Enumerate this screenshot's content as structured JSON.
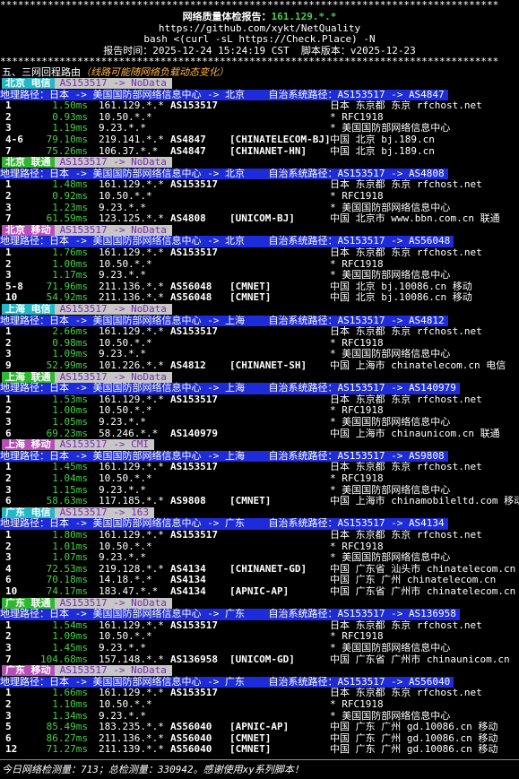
{
  "header": {
    "stars": "************************************************************************************",
    "title_prefix": "网络质量体检报告：",
    "title_ip": "161.129.*.*",
    "url": "https://github.com/xykt/NetQuality",
    "cmd": "bash <(curl -sL https://Check.Place) -N",
    "report_time": "报告时间：2025-12-24 15:24:19 CST  脚本版本：v2025-12-23",
    "stars2": "************************************************************************************"
  },
  "section": {
    "title": "五、三网回程路由",
    "note": "（线路可能随网络负载动态变化）"
  },
  "routes": [
    {
      "badge": "北京 电信",
      "badge_type": "ct",
      "as_badge": "AS153517 -> NoData",
      "geo": "地理路径：日本 -> 美国国防部网络信息中心 -> 北京    自治系统路径：AS153517 -> AS4847",
      "hops": [
        {
          "n": "1",
          "ms": "1.50ms",
          "ip": "161.129.*.*",
          "asn": "AS153517",
          "isp": "",
          "loc": "日本 东京都 东京 rfchost.net"
        },
        {
          "n": "2",
          "ms": "0.93ms",
          "ip": "10.50.*.*",
          "asn": "",
          "isp": "",
          "loc": "* RFC1918"
        },
        {
          "n": "3",
          "ms": "1.19ms",
          "ip": "9.23.*.*",
          "asn": "",
          "isp": "",
          "loc": "* 美国国防部网络信息中心"
        },
        {
          "n": "4-6",
          "ms": "79.10ms",
          "ip": "219.141.*.*",
          "asn": "AS4847",
          "isp": "[CHINATELECOM-BJ]",
          "loc": "中国 北京 bj.189.cn"
        },
        {
          "n": "7",
          "ms": "75.26ms",
          "ip": "106.37.*.*",
          "asn": "AS4847",
          "isp": "[CHINANET-HN]",
          "loc": "中国 北京 bj.189.cn"
        }
      ]
    },
    {
      "badge": "北京 联通",
      "badge_type": "cu",
      "as_badge": "AS153517 -> NoData",
      "geo": "地理路径：日本 -> 美国国防部网络信息中心 -> 北京    自治系统路径：AS153517 -> AS4808",
      "hops": [
        {
          "n": "1",
          "ms": "1.48ms",
          "ip": "161.129.*.*",
          "asn": "AS153517",
          "isp": "",
          "loc": "日本 东京都 东京 rfchost.net"
        },
        {
          "n": "2",
          "ms": "0.92ms",
          "ip": "10.50.*.*",
          "asn": "",
          "isp": "",
          "loc": "* RFC1918"
        },
        {
          "n": "3",
          "ms": "1.23ms",
          "ip": "9.23.*.*",
          "asn": "",
          "isp": "",
          "loc": "* 美国国防部网络信息中心"
        },
        {
          "n": "7",
          "ms": "61.59ms",
          "ip": "123.125.*.*",
          "asn": "AS4808",
          "isp": "[UNICOM-BJ]",
          "loc": "中国 北京市 www.bbn.com.cn 联通"
        }
      ]
    },
    {
      "badge": "北京 移动",
      "badge_type": "cm",
      "as_badge": "AS153517 -> NoData",
      "geo": "地理路径：日本 -> 美国国防部网络信息中心 -> 北京    自治系统路径：AS153517 -> AS56048",
      "hops": [
        {
          "n": "1",
          "ms": "1.76ms",
          "ip": "161.129.*.*",
          "asn": "AS153517",
          "isp": "",
          "loc": "日本 东京都 东京 rfchost.net"
        },
        {
          "n": "2",
          "ms": "1.00ms",
          "ip": "10.50.*.*",
          "asn": "",
          "isp": "",
          "loc": "* RFC1918"
        },
        {
          "n": "3",
          "ms": "1.17ms",
          "ip": "9.23.*.*",
          "asn": "",
          "isp": "",
          "loc": "* 美国国防部网络信息中心"
        },
        {
          "n": "5-8",
          "ms": "71.96ms",
          "ip": "211.136.*.*",
          "asn": "AS56048",
          "isp": "[CMNET]",
          "loc": "中国 北京 bj.10086.cn 移动"
        },
        {
          "n": "10",
          "ms": "54.92ms",
          "ip": "211.136.*.*",
          "asn": "AS56048",
          "isp": "[CMNET]",
          "loc": "中国 北京 bj.10086.cn 移动"
        }
      ]
    },
    {
      "badge": "上海 电信",
      "badge_type": "ct",
      "as_badge": "AS153517 -> NoData",
      "geo": "地理路径：日本 -> 美国国防部网络信息中心 -> 上海    自治系统路径：AS153517 -> AS4812",
      "hops": [
        {
          "n": "1",
          "ms": "2.66ms",
          "ip": "161.129.*.*",
          "asn": "AS153517",
          "isp": "",
          "loc": "日本 东京都 东京 rfchost.net"
        },
        {
          "n": "2",
          "ms": "0.98ms",
          "ip": "10.50.*.*",
          "asn": "",
          "isp": "",
          "loc": "* RFC1918"
        },
        {
          "n": "3",
          "ms": "1.09ms",
          "ip": "9.23.*.*",
          "asn": "",
          "isp": "",
          "loc": "* 美国国防部网络信息中心"
        },
        {
          "n": "9",
          "ms": "52.99ms",
          "ip": "101.226.*.*",
          "asn": "AS4812",
          "isp": "[CHINANET-SH]",
          "loc": "中国 上海市 chinatelecom.cn 电信"
        }
      ]
    },
    {
      "badge": "上海 联通",
      "badge_type": "cu",
      "as_badge": "AS153517 -> NoData",
      "geo": "地理路径：日本 -> 美国国防部网络信息中心 -> 上海    自治系统路径：AS153517 -> AS140979",
      "hops": [
        {
          "n": "1",
          "ms": "1.53ms",
          "ip": "161.129.*.*",
          "asn": "AS153517",
          "isp": "",
          "loc": "日本 东京都 东京 rfchost.net"
        },
        {
          "n": "2",
          "ms": "1.00ms",
          "ip": "10.50.*.*",
          "asn": "",
          "isp": "",
          "loc": "* RFC1918"
        },
        {
          "n": "3",
          "ms": "1.05ms",
          "ip": "9.23.*.*",
          "asn": "",
          "isp": "",
          "loc": "* 美国国防部网络信息中心"
        },
        {
          "n": "6",
          "ms": "69.23ms",
          "ip": "58.246.*.*",
          "asn": "AS140979",
          "isp": "",
          "loc": "中国 上海市 chinaunicom.cn 联通"
        }
      ]
    },
    {
      "badge": "上海 移动",
      "badge_type": "cm",
      "as_badge": "AS153517 -> CMI",
      "geo": "地理路径：日本 -> 美国国防部网络信息中心 -> 上海    自治系统路径：AS153517 -> AS9808",
      "hops": [
        {
          "n": "1",
          "ms": "1.45ms",
          "ip": "161.129.*.*",
          "asn": "AS153517",
          "isp": "",
          "loc": "日本 东京都 东京 rfchost.net"
        },
        {
          "n": "2",
          "ms": "1.04ms",
          "ip": "10.50.*.*",
          "asn": "",
          "isp": "",
          "loc": "* RFC1918"
        },
        {
          "n": "3",
          "ms": "1.15ms",
          "ip": "9.23.*.*",
          "asn": "",
          "isp": "",
          "loc": "* 美国国防部网络信息中心"
        },
        {
          "n": "6",
          "ms": "58.63ms",
          "ip": "117.185.*.*",
          "asn": "AS9808",
          "isp": "[CMNET]",
          "loc": "中国 上海市 chinamobileltd.com 移动"
        }
      ]
    },
    {
      "badge": "广东 电信",
      "badge_type": "ct",
      "as_badge": "AS153517 -> 163",
      "geo": "地理路径：日本 -> 美国国防部网络信息中心 -> 广东    自治系统路径：AS153517 -> AS4134",
      "hops": [
        {
          "n": "1",
          "ms": "1.80ms",
          "ip": "161.129.*.*",
          "asn": "AS153517",
          "isp": "",
          "loc": "日本 东京都 东京 rfchost.net"
        },
        {
          "n": "2",
          "ms": "1.01ms",
          "ip": "10.50.*.*",
          "asn": "",
          "isp": "",
          "loc": "* RFC1918"
        },
        {
          "n": "3",
          "ms": "1.07ms",
          "ip": "9.23.*.*",
          "asn": "",
          "isp": "",
          "loc": "* 美国国防部网络信息中心"
        },
        {
          "n": "4",
          "ms": "72.53ms",
          "ip": "219.128.*.*",
          "asn": "AS4134",
          "isp": "[CHINANET-GD]",
          "loc": "中国 广东省 汕头市 chinatelecom.cn"
        },
        {
          "n": "6",
          "ms": "70.18ms",
          "ip": "14.18.*.*",
          "asn": "AS4134",
          "isp": "",
          "loc": "中国 广东 广州 chinatelecom.cn"
        },
        {
          "n": "10",
          "ms": "74.17ms",
          "ip": "183.47.*.*",
          "asn": "AS4134",
          "isp": "[APNIC-AP]",
          "loc": "中国 广东省 广州市 chinatelecom.cn"
        }
      ]
    },
    {
      "badge": "广东 联通",
      "badge_type": "cu",
      "as_badge": "AS153517 -> NoData",
      "geo": "地理路径：日本 -> 美国国防部网络信息中心 -> 广东    自治系统路径：AS153517 -> AS136958",
      "hops": [
        {
          "n": "1",
          "ms": "1.54ms",
          "ip": "161.129.*.*",
          "asn": "AS153517",
          "isp": "",
          "loc": "日本 东京都 东京 rfchost.net"
        },
        {
          "n": "2",
          "ms": "1.09ms",
          "ip": "10.50.*.*",
          "asn": "",
          "isp": "",
          "loc": "* RFC1918"
        },
        {
          "n": "3",
          "ms": "1.45ms",
          "ip": "9.23.*.*",
          "asn": "",
          "isp": "",
          "loc": "* 美国国防部网络信息中心"
        },
        {
          "n": "7",
          "ms": "104.68ms",
          "ip": "157.148.*.*",
          "asn": "AS136958",
          "isp": "[UNICOM-GD]",
          "loc": "中国 广东省 广州市 chinaunicom.cn"
        }
      ]
    },
    {
      "badge": "广东 移动",
      "badge_type": "cm",
      "as_badge": "AS153517 -> NoData",
      "geo": "地理路径：日本 -> 美国国防部网络信息中心 -> 广东    自治系统路径：AS153517 -> AS56040",
      "hops": [
        {
          "n": "1",
          "ms": "1.66ms",
          "ip": "161.129.*.*",
          "asn": "AS153517",
          "isp": "",
          "loc": "日本 东京都 东京 rfchost.net"
        },
        {
          "n": "2",
          "ms": "1.10ms",
          "ip": "10.50.*.*",
          "asn": "",
          "isp": "",
          "loc": "* RFC1918"
        },
        {
          "n": "3",
          "ms": "1.34ms",
          "ip": "9.23.*.*",
          "asn": "",
          "isp": "",
          "loc": "* 美国国防部网络信息中心"
        },
        {
          "n": "5",
          "ms": "85.49ms",
          "ip": "183.235.*.*",
          "asn": "AS56040",
          "isp": "[APNIC-AP]",
          "loc": "中国 广东 广州 gd.10086.cn 移动"
        },
        {
          "n": "6",
          "ms": "86.27ms",
          "ip": "211.136.*.*",
          "asn": "AS56040",
          "isp": "[CMNET]",
          "loc": "中国 广东 广州 gd.10086.cn 移动"
        },
        {
          "n": "12",
          "ms": "71.27ms",
          "ip": "211.139.*.*",
          "asn": "AS56040",
          "isp": "[CMNET]",
          "loc": "中国 广东 广州 gd.10086.cn 移动"
        }
      ]
    }
  ],
  "footer": "今日网络检测量：713；总检测量：330942。感谢使用xy系列脚本！",
  "colors": {
    "background": "#000000",
    "green": "#47d147",
    "telecom_badge": "#23b8c6",
    "unicom_badge": "#2fb82f",
    "mobile_badge": "#b84fb8",
    "as_badge_bg": "#c7c7c7",
    "as_badge_text": "#7a2ab3",
    "geo_bar": "#1d2bd9"
  }
}
